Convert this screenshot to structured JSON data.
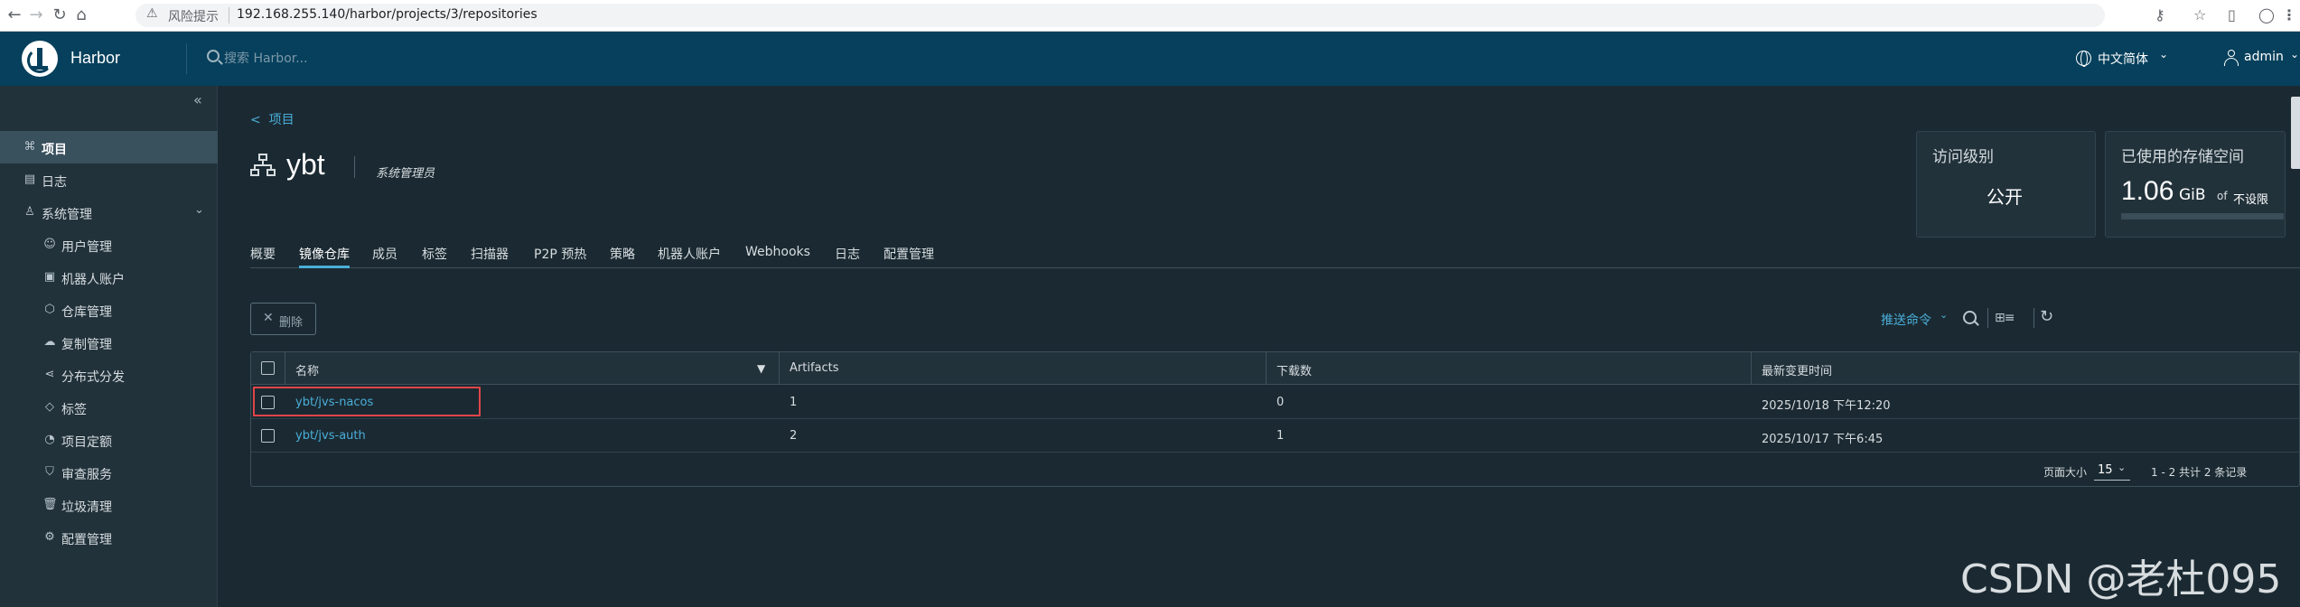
{
  "browser": {
    "warning_label": "风险提示",
    "url": "192.168.255.140/harbor/projects/3/repositories"
  },
  "header": {
    "brand": "Harbor",
    "search_placeholder": "搜索 Harbor...",
    "language": "中文简体",
    "user": "admin"
  },
  "sidebar": {
    "items": [
      {
        "label": "项目",
        "icon": "project-icon",
        "active": true
      },
      {
        "label": "日志",
        "icon": "log-icon"
      },
      {
        "label": "系统管理",
        "icon": "admin-icon",
        "expanded": true
      }
    ],
    "sub_items": [
      {
        "label": "用户管理",
        "icon": "users-icon"
      },
      {
        "label": "机器人账户",
        "icon": "robot-icon"
      },
      {
        "label": "仓库管理",
        "icon": "registry-icon"
      },
      {
        "label": "复制管理",
        "icon": "replication-icon"
      },
      {
        "label": "分布式分发",
        "icon": "distribution-icon"
      },
      {
        "label": "标签",
        "icon": "tag-icon"
      },
      {
        "label": "项目定额",
        "icon": "quota-icon"
      },
      {
        "label": "审查服务",
        "icon": "shield-icon"
      },
      {
        "label": "垃圾清理",
        "icon": "trash-icon"
      },
      {
        "label": "配置管理",
        "icon": "gear-icon"
      }
    ]
  },
  "project": {
    "back_label": "项目",
    "name": "ybt",
    "role": "系统管理员",
    "access_card": {
      "title": "访问级别",
      "value": "公开"
    },
    "storage_card": {
      "title": "已使用的存储空间",
      "value": "1.06",
      "unit": "GiB",
      "of": "of",
      "limit": "不设限"
    }
  },
  "tabs": [
    {
      "label": "概要"
    },
    {
      "label": "镜像仓库",
      "active": true
    },
    {
      "label": "成员"
    },
    {
      "label": "标签"
    },
    {
      "label": "扫描器"
    },
    {
      "label": "P2P 预热"
    },
    {
      "label": "策略"
    },
    {
      "label": "机器人账户"
    },
    {
      "label": "Webhooks"
    },
    {
      "label": "日志"
    },
    {
      "label": "配置管理"
    }
  ],
  "toolbar": {
    "delete_label": "删除",
    "push_command_label": "推送命令"
  },
  "table": {
    "columns": [
      "名称",
      "Artifacts",
      "下载数",
      "最新变更时间"
    ],
    "rows": [
      {
        "name": "ybt/jvs-nacos",
        "artifacts": "1",
        "downloads": "0",
        "updated": "2025/10/18 下午12:20",
        "highlighted": true
      },
      {
        "name": "ybt/jvs-auth",
        "artifacts": "2",
        "downloads": "1",
        "updated": "2025/10/17 下午6:45"
      }
    ],
    "footer": {
      "page_size_label": "页面大小",
      "page_size": "15",
      "summary": "1 - 2 共计 2 条记录"
    }
  },
  "watermark": "CSDN @老杜095",
  "colors": {
    "header_bg": "#06405c",
    "sidebar_bg": "#22323b",
    "main_bg": "#1b2a32",
    "accent": "#4aaed9",
    "highlight": "#e0454a"
  }
}
